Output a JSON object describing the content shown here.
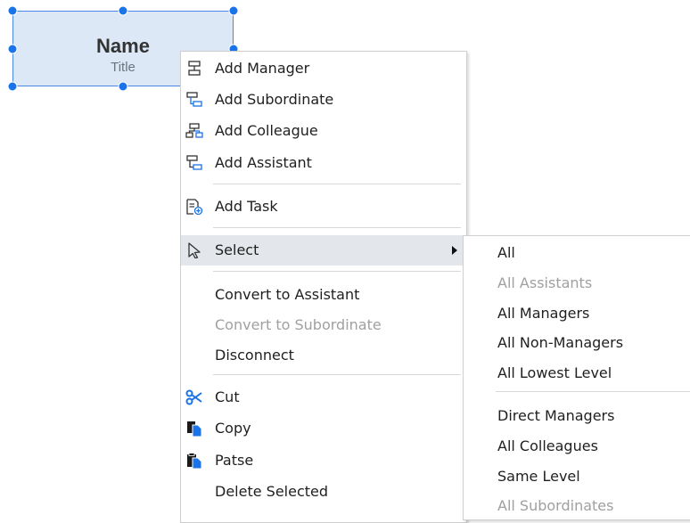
{
  "shape": {
    "name": "Name",
    "title": "Title"
  },
  "context_menu": {
    "add_manager": "Add Manager",
    "add_subordinate": "Add Subordinate",
    "add_colleague": "Add Colleague",
    "add_assistant": "Add Assistant",
    "add_task": "Add Task",
    "select": "Select",
    "convert_to_assistant": "Convert to Assistant",
    "convert_to_subordinate": "Convert to Subordinate",
    "disconnect": "Disconnect",
    "cut": "Cut",
    "copy": "Copy",
    "paste": "Patse",
    "delete_selected": "Delete Selected"
  },
  "select_submenu": {
    "all": "All",
    "all_assistants": "All Assistants",
    "all_managers": "All Managers",
    "all_non_managers": "All Non-Managers",
    "all_lowest_level": "All Lowest Level",
    "direct_managers": "Direct Managers",
    "all_colleagues": "All Colleagues",
    "same_level": "Same Level",
    "all_subordinates": "All Subordinates"
  },
  "colors": {
    "selection_accent": "#1a73e8",
    "shape_fill": "#dce8f6",
    "hover_bg": "#e3e6ea",
    "disabled_text": "#a0a0a0"
  }
}
